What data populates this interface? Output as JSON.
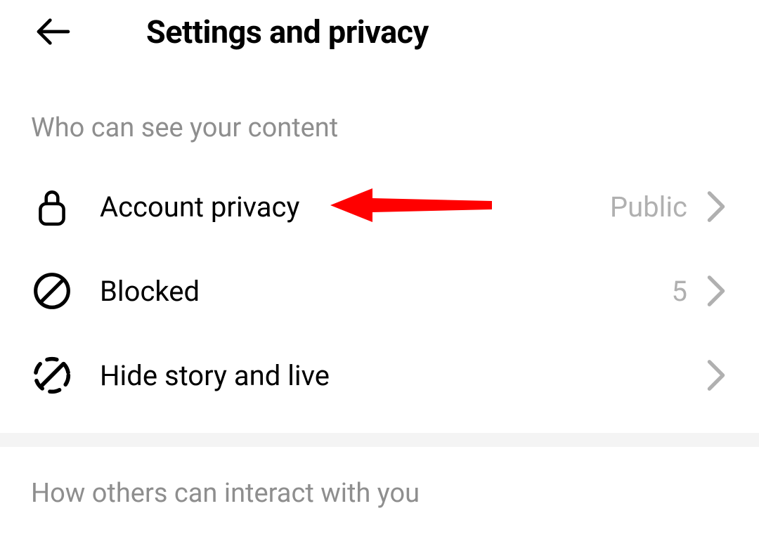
{
  "header": {
    "title": "Settings and privacy"
  },
  "sections": {
    "see_content": {
      "title": "Who can see your content",
      "items": {
        "account_privacy": {
          "label": "Account privacy",
          "value": "Public"
        },
        "blocked": {
          "label": "Blocked",
          "value": "5"
        },
        "hide_story": {
          "label": "Hide story and live",
          "value": ""
        }
      }
    },
    "interact": {
      "title": "How others can interact with you"
    }
  },
  "annotation": {
    "arrow_color": "#ff0000",
    "arrow_target": "account_privacy"
  }
}
